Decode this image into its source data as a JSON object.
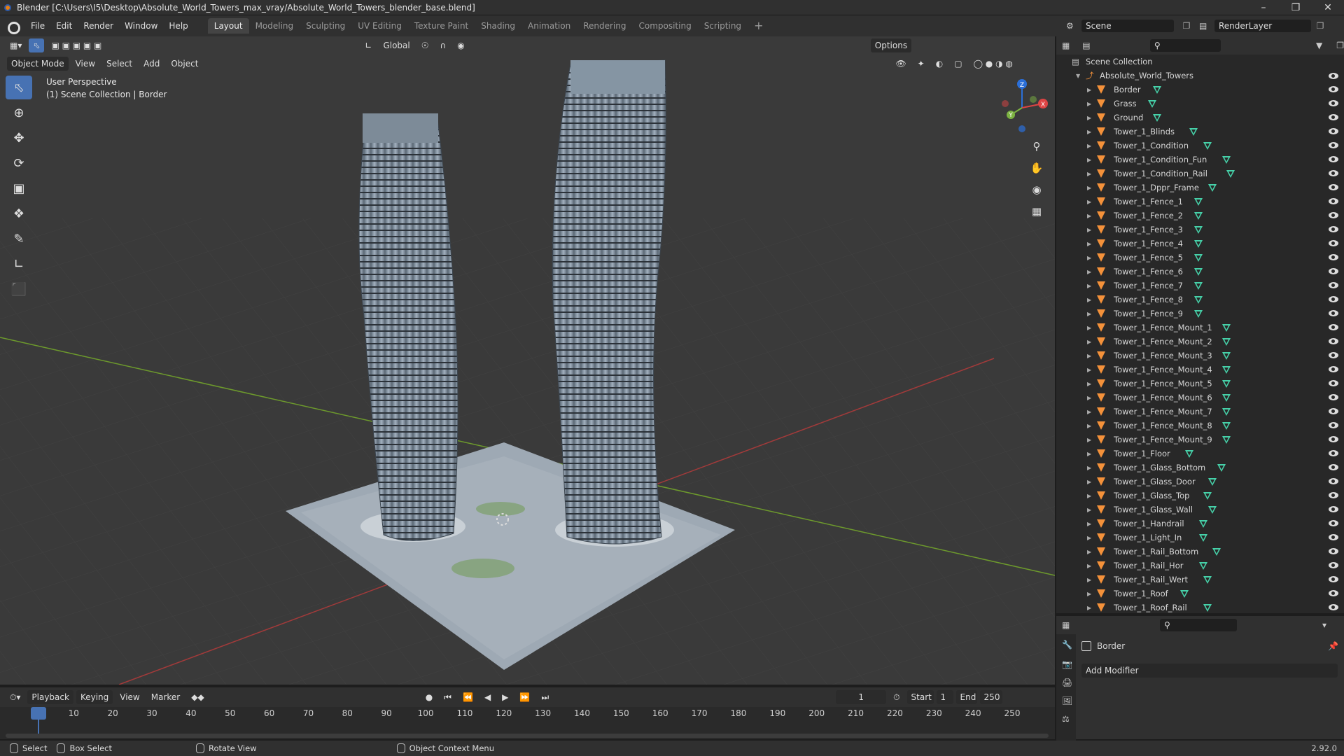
{
  "window": {
    "title": "Blender [C:\\Users\\I5\\Desktop\\Absolute_World_Towers_max_vray/Absolute_World_Towers_blender_base.blend]"
  },
  "menu": [
    "File",
    "Edit",
    "Render",
    "Window",
    "Help"
  ],
  "workspaces": [
    "Layout",
    "Modeling",
    "Sculpting",
    "UV Editing",
    "Texture Paint",
    "Shading",
    "Animation",
    "Rendering",
    "Compositing",
    "Scripting"
  ],
  "active_workspace": "Layout",
  "scene": {
    "name": "Scene",
    "layer": "RenderLayer"
  },
  "viewport": {
    "orientation": "Global",
    "options_label": "Options",
    "mode": "Object Mode",
    "menus": [
      "View",
      "Select",
      "Add",
      "Object"
    ],
    "info_line1": "User Perspective",
    "info_line2": "(1) Scene Collection | Border",
    "gizmo": {
      "x": "X",
      "y": "Y",
      "z": "Z"
    }
  },
  "outliner": {
    "root": "Scene Collection",
    "collection": "Absolute_World_Towers",
    "items": [
      "Border",
      "Grass",
      "Ground",
      "Tower_1_Blinds",
      "Tower_1_Condition",
      "Tower_1_Condition_Fun",
      "Tower_1_Condition_Rail",
      "Tower_1_Dppr_Frame",
      "Tower_1_Fence_1",
      "Tower_1_Fence_2",
      "Tower_1_Fence_3",
      "Tower_1_Fence_4",
      "Tower_1_Fence_5",
      "Tower_1_Fence_6",
      "Tower_1_Fence_7",
      "Tower_1_Fence_8",
      "Tower_1_Fence_9",
      "Tower_1_Fence_Mount_1",
      "Tower_1_Fence_Mount_2",
      "Tower_1_Fence_Mount_3",
      "Tower_1_Fence_Mount_4",
      "Tower_1_Fence_Mount_5",
      "Tower_1_Fence_Mount_6",
      "Tower_1_Fence_Mount_7",
      "Tower_1_Fence_Mount_8",
      "Tower_1_Fence_Mount_9",
      "Tower_1_Floor",
      "Tower_1_Glass_Bottom",
      "Tower_1_Glass_Door",
      "Tower_1_Glass_Top",
      "Tower_1_Glass_Wall",
      "Tower_1_Handrail",
      "Tower_1_Light_In",
      "Tower_1_Rail_Bottom",
      "Tower_1_Rail_Hor",
      "Tower_1_Rail_Wert",
      "Tower_1_Roof",
      "Tower_1_Roof_Rail"
    ]
  },
  "properties": {
    "object_name": "Border",
    "add_modifier": "Add Modifier"
  },
  "timeline": {
    "menus": [
      "Playback",
      "Keying",
      "View",
      "Marker"
    ],
    "current_frame": "1",
    "start_label": "Start",
    "start": "1",
    "end_label": "End",
    "end": "250",
    "ticks": [
      "1",
      "10",
      "20",
      "30",
      "40",
      "50",
      "60",
      "70",
      "80",
      "90",
      "100",
      "110",
      "120",
      "130",
      "140",
      "150",
      "160",
      "170",
      "180",
      "190",
      "200",
      "210",
      "220",
      "230",
      "240",
      "250"
    ]
  },
  "statusbar": {
    "select": "Select",
    "box_select": "Box Select",
    "rotate_view": "Rotate View",
    "context_menu": "Object Context Menu",
    "version": "2.92.0"
  }
}
